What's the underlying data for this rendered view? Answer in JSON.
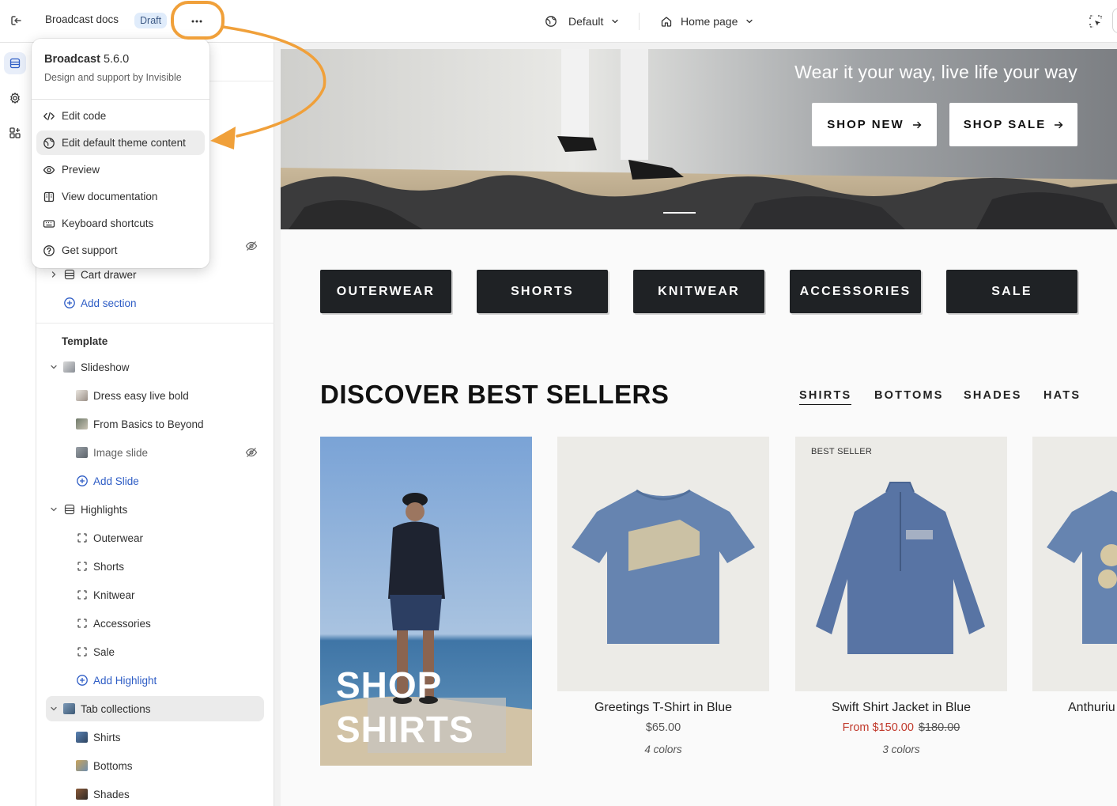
{
  "topbar": {
    "title": "Broadcast docs",
    "badge": "Draft",
    "theme_selector": "Default",
    "page_selector": "Home page"
  },
  "menu": {
    "theme_name": "Broadcast",
    "theme_version": "5.6.0",
    "subtitle": "Design and support by Invisible",
    "items": [
      {
        "label": "Edit code",
        "icon": "code-icon"
      },
      {
        "label": "Edit default theme content",
        "icon": "globe-icon"
      },
      {
        "label": "Preview",
        "icon": "eye-icon"
      },
      {
        "label": "View documentation",
        "icon": "book-icon"
      },
      {
        "label": "Keyboard shortcuts",
        "icon": "keyboard-icon"
      },
      {
        "label": "Get support",
        "icon": "help-icon"
      }
    ]
  },
  "sidebar": {
    "cart_drawer": "Cart drawer",
    "add_section": "Add section",
    "template_heading": "Template",
    "slideshow": "Slideshow",
    "slides": [
      "Dress easy live bold",
      "From Basics to Beyond",
      "Image slide"
    ],
    "add_slide": "Add Slide",
    "highlights": "Highlights",
    "highlight_items": [
      "Outerwear",
      "Shorts",
      "Knitwear",
      "Accessories",
      "Sale"
    ],
    "add_highlight": "Add Highlight",
    "tab_collections": "Tab collections",
    "tab_items": [
      "Shirts",
      "Bottoms",
      "Shades"
    ]
  },
  "preview": {
    "hero_tagline": "Wear it your way, live life your way",
    "hero_buttons": [
      "SHOP NEW",
      "SHOP SALE"
    ],
    "categories": [
      "OUTERWEAR",
      "SHORTS",
      "KNITWEAR",
      "ACCESSORIES",
      "SALE"
    ],
    "section_title": "DISCOVER BEST SELLERS",
    "tabs": [
      "SHIRTS",
      "BOTTOMS",
      "SHADES",
      "HATS"
    ],
    "promo_line1": "SHOP",
    "promo_line2": "SHIRTS",
    "products": [
      {
        "name": "Greetings T-Shirt in Blue",
        "price": "$65.00",
        "colors": "4 colors"
      },
      {
        "name": "Swift Shirt Jacket in Blue",
        "price": "From $150.00",
        "compare_price": "$180.00",
        "colors": "3 colors",
        "badge": "BEST SELLER"
      },
      {
        "name": "Anthuriu"
      }
    ]
  },
  "colors": {
    "accent_blue": "#2d5cc5",
    "annotation_orange": "#f0a03a",
    "category_bg": "#1f2225",
    "sale_red": "#c0392b"
  }
}
